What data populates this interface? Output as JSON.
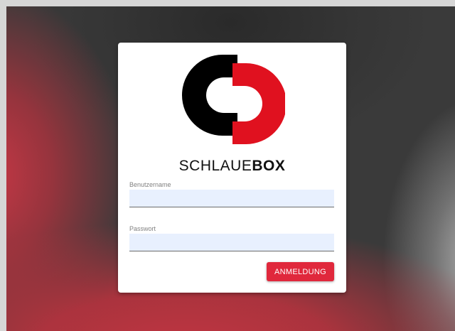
{
  "brand": {
    "name_light": "SCHLAUE",
    "name_bold": "BOX"
  },
  "login_form": {
    "username_label": "Benutzername",
    "username_value": "",
    "password_label": "Passwort",
    "password_value": "",
    "submit_label": "ANMELDUNG"
  },
  "colors": {
    "accent": "#e0283c",
    "logo_black": "#000000",
    "logo_red": "#e0111f",
    "input_background": "#e8f0fe"
  },
  "icons": {
    "logo": "schlauebox-logo-icon"
  }
}
